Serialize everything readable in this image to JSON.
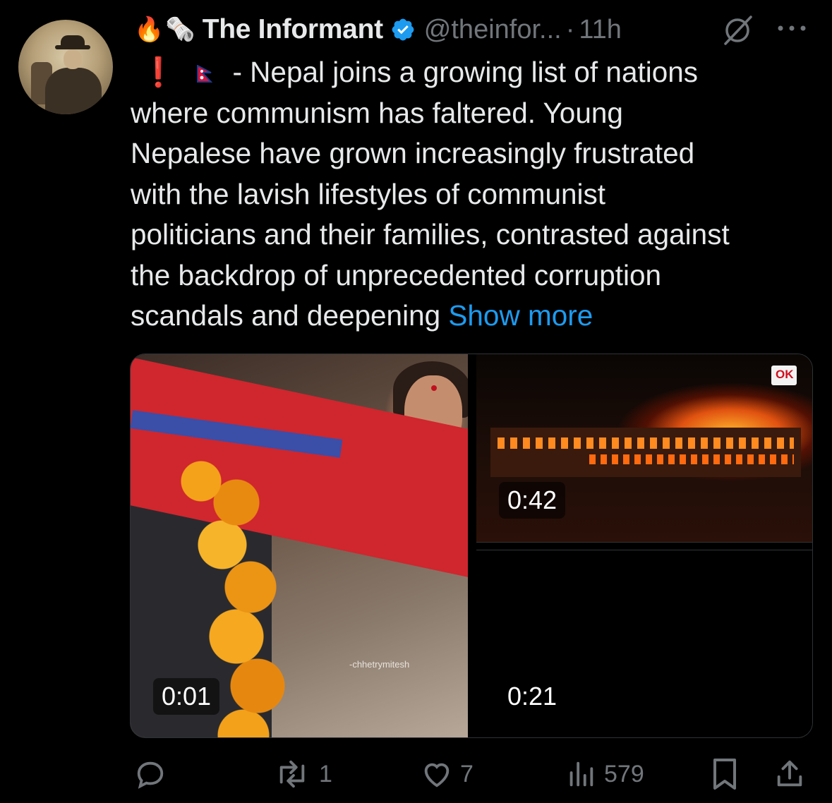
{
  "tweet": {
    "emojis": [
      "🔥",
      "🗞️"
    ],
    "author_name": "The Informant",
    "handle": "@theinfor...",
    "separator": "·",
    "time": "11h",
    "lead_emojis": [
      "❗",
      "🇳🇵"
    ],
    "text_lines": [
      "- Nepal joins a growing list of nations",
      "where communism has faltered. Young",
      "Nepalese have grown increasingly frustrated",
      "with the lavish lifestyles of communist",
      "politicians and their families, contrasted against",
      "the backdrop of unprecedented corruption",
      "scandals and deepening"
    ],
    "show_more": "Show more"
  },
  "media": {
    "videos": [
      {
        "duration": "0:01",
        "watermark": "-chhetrymitesh"
      },
      {
        "duration": "0:42",
        "logo": "OK"
      },
      {
        "duration": "0:21"
      }
    ]
  },
  "actions": {
    "reply_count": "",
    "retweet_count": "1",
    "like_count": "7",
    "views_count": "579"
  },
  "colors": {
    "background": "#000000",
    "text": "#e7e9ea",
    "muted": "#71767b",
    "link": "#1d9bf0",
    "verified": "#1d9bf0"
  },
  "icons": [
    "avatar",
    "verified-icon",
    "grok-icon",
    "more-icon",
    "reply-icon",
    "retweet-icon",
    "like-icon",
    "views-icon",
    "bookmark-icon",
    "share-icon"
  ]
}
